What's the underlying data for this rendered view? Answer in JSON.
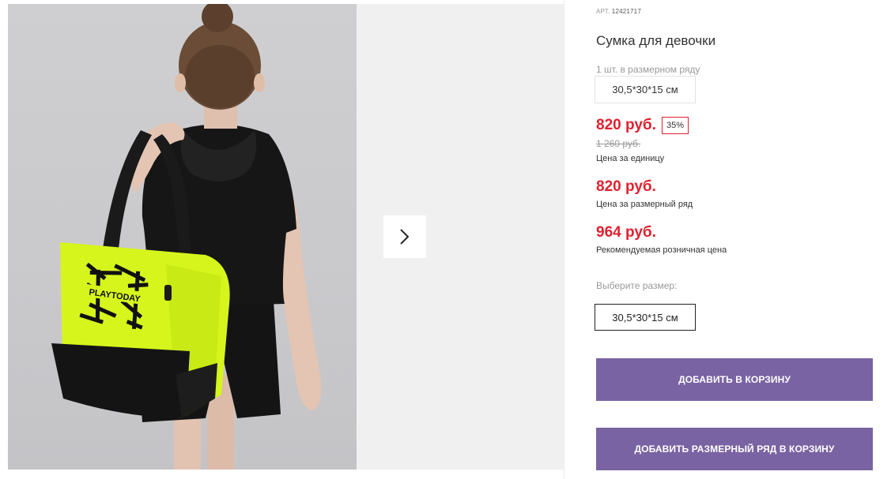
{
  "product": {
    "article_prefix": "АРТ.",
    "article_number": "12421717",
    "title": "Сумка для девочки",
    "pieces_in_row": "1 шт. в размерном ряду",
    "size_range": "30,5*30*15 см"
  },
  "prices": {
    "current": "820 руб.",
    "discount": "35%",
    "old": "1 260 руб.",
    "unit_label": "Цена за единицу",
    "row_price": "820 руб.",
    "row_price_label": "Цена за размерный ряд",
    "retail_price": "964 руб.",
    "retail_label": "Рекомендуемая розничная цена"
  },
  "size_select": {
    "label": "Выберите размер:",
    "options": [
      "30,5*30*15 см"
    ],
    "selected": "30,5*30*15 см"
  },
  "actions": {
    "add_to_cart": "ДОБАВИТЬ В КОРЗИНУ",
    "add_row_to_cart": "ДОБАВИТЬ РАЗМЕРНЫЙ РЯД В КОРЗИНУ"
  },
  "gallery": {
    "bag_print_text": "PLAYTODAY",
    "next_icon": "chevron-right-icon"
  },
  "colors": {
    "price_red": "#e0212f",
    "button_purple": "#7a63a2",
    "bag_neon": "#d6f51c"
  }
}
